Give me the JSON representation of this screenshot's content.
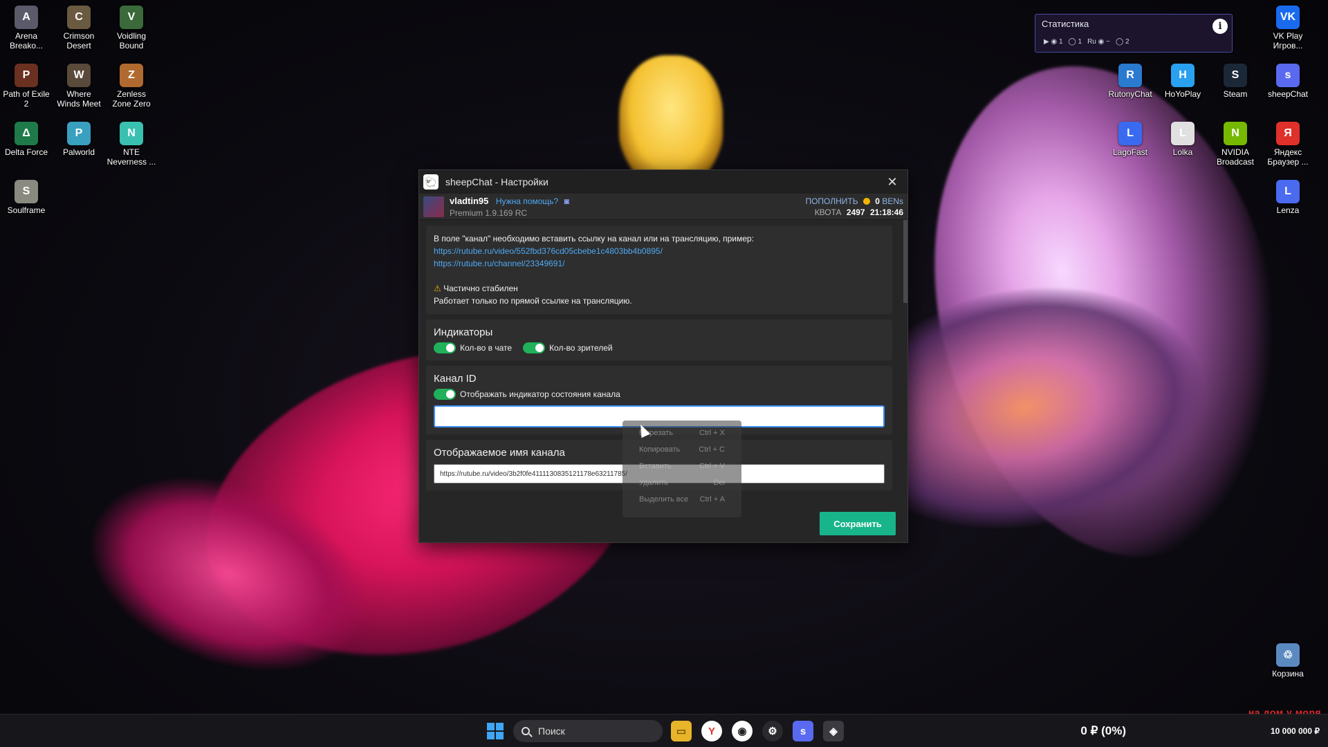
{
  "desktop_icons": [
    {
      "label": "Arena Breako...",
      "color": "#5a5a6a",
      "glyph": "A"
    },
    {
      "label": "Crimson Desert",
      "color": "#6a5a40",
      "glyph": "C"
    },
    {
      "label": "Voidling Bound",
      "color": "#3a6a3a",
      "glyph": "V"
    },
    {
      "label": "Path of Exile 2",
      "color": "#6a3020",
      "glyph": "P"
    },
    {
      "label": "Where Winds Meet",
      "color": "#5a4a3a",
      "glyph": "W"
    },
    {
      "label": "Zenless Zone Zero",
      "color": "#b06a30",
      "glyph": "Z"
    },
    {
      "label": "Delta Force",
      "color": "#1f7a4a",
      "glyph": "Δ"
    },
    {
      "label": "Palworld",
      "color": "#3aa0c0",
      "glyph": "P"
    },
    {
      "label": "NTE Neverness ...",
      "color": "#3ac0b0",
      "glyph": "N"
    },
    {
      "label": "Soulframe",
      "color": "#8a8a80",
      "glyph": "S"
    },
    {
      "label": "VK Play Игров...",
      "color": "#1a6af0",
      "glyph": "VK"
    },
    {
      "label": "RutonyChat",
      "color": "#2a7ad0",
      "glyph": "R"
    },
    {
      "label": "HoYoPlay",
      "color": "#2aa0f0",
      "glyph": "H"
    },
    {
      "label": "Steam",
      "color": "#1b2838",
      "glyph": "S"
    },
    {
      "label": "sheepChat",
      "color": "#5a6af0",
      "glyph": "s"
    },
    {
      "label": "LagoFast",
      "color": "#3a6af0",
      "glyph": "L"
    },
    {
      "label": "Lolka",
      "color": "#e0e0e0",
      "glyph": "L"
    },
    {
      "label": "NVIDIA Broadcast",
      "color": "#76b900",
      "glyph": "N"
    },
    {
      "label": "Яндекс Браузер ...",
      "color": "#e0302a",
      "glyph": "Я"
    },
    {
      "label": "Lenza",
      "color": "#4a6af0",
      "glyph": "L"
    },
    {
      "label": "Корзина",
      "color": "#5a8ac0",
      "glyph": "♲"
    }
  ],
  "stats_widget": {
    "title": "Статистика",
    "items": [
      "▶ ◉ 1",
      "◯ 1",
      "Ru ◉ ~",
      "◯ 2"
    ],
    "info_icon": "i"
  },
  "window": {
    "title": "sheepChat - Настройки",
    "close_glyph": "✕",
    "user": {
      "name": "vladtin95",
      "help_link": "Нужна помощь?",
      "version": "Premium 1.9.169 RC"
    },
    "quota": {
      "topup_label": "ПОПОЛНИТЬ",
      "balance": "0",
      "currency": "BENs",
      "quota_label": "КВОТА",
      "quota_value": "2497",
      "time": "21:18:46"
    },
    "note": {
      "text": "В поле \"канал\" необходимо вставить ссылку на канал или на трансляцию, пример:",
      "link1": "https://rutube.ru/video/552fbd376cd05cbebe1c4803bb4b0895/",
      "link2": "https://rutube.ru/channel/23349691/",
      "warning_title": "Частично стабилен",
      "warning_text": "Работает только по прямой ссылке на трансляцию."
    },
    "indicators": {
      "title": "Индикаторы",
      "toggle1": "Кол-во в чате",
      "toggle2": "Кол-во зрителей"
    },
    "channel_id": {
      "title": "Канал ID",
      "toggle": "Отображать индикатор состояния канала",
      "value": ""
    },
    "display_name": {
      "title": "Отображаемое имя канала",
      "value": "https://rutube.ru/video/3b2f0fe4111130835121178e63211785/"
    },
    "save_label": "Сохранить"
  },
  "context_menu": [
    {
      "label": "Вырезать",
      "shortcut": "Ctrl + X"
    },
    {
      "label": "Копировать",
      "shortcut": "Ctrl + C"
    },
    {
      "label": "Вставить",
      "shortcut": "Ctrl + V"
    },
    {
      "label": "Удалить",
      "shortcut": "Del"
    },
    {
      "label": "Выделить все",
      "shortcut": "Ctrl + A"
    }
  ],
  "taskbar": {
    "search_label": "Поиск",
    "balance": "0 ₽ (0%)",
    "money": "10 000 000 ₽"
  },
  "watermark": "на дом у моря"
}
